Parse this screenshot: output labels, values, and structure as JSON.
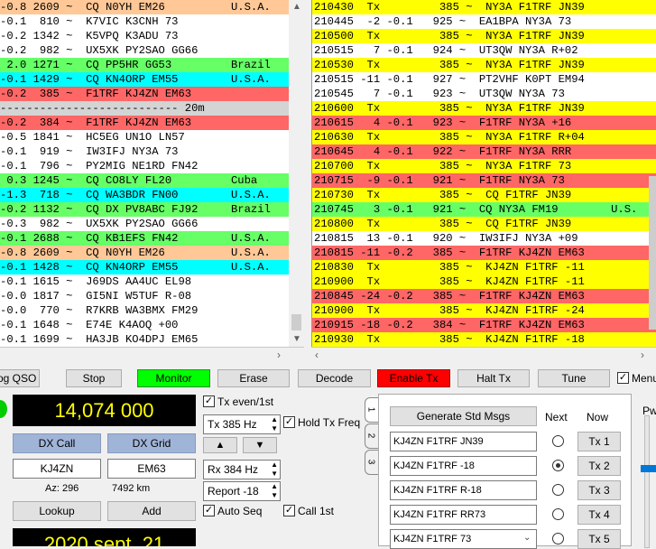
{
  "colors": {
    "cq_peach": "#ffc896",
    "cq_green": "#66ff66",
    "cq_cyan": "#00ffff",
    "to_me_red": "#ff6666",
    "tx_yellow": "#ffff00",
    "monitor_green": "#00ff00",
    "enable_tx_red": "#ff0000",
    "freq_text": "#ffff00"
  },
  "band_activity": {
    "rows": [
      {
        "text": "-0.8 2609 ~  CQ N0YH EM26          U.S.A.",
        "color": "#ffc896"
      },
      {
        "text": "-0.1  810 ~  K7VIC K3CNH 73",
        "color": ""
      },
      {
        "text": "-0.2 1342 ~  K5VPQ K3ADU 73",
        "color": ""
      },
      {
        "text": "-0.2  982 ~  UX5XK PY2SAO GG66",
        "color": ""
      },
      {
        "text": " 2.0 1271 ~  CQ PP5HR GG53         Brazil",
        "color": "#66ff66"
      },
      {
        "text": "-0.1 1429 ~  CQ KN4ORP EM55        U.S.A.",
        "color": "#00ffff"
      },
      {
        "text": "-0.2  385 ~  F1TRF KJ4ZN EM63",
        "color": "#ff6666"
      },
      {
        "text": "--------------------------- 20m",
        "color": "#d4d4d4"
      },
      {
        "text": "-0.2  384 ~  F1TRF KJ4ZN EM63",
        "color": "#ff6666"
      },
      {
        "text": "-0.5 1841 ~  HC5EG UN1O LN57",
        "color": ""
      },
      {
        "text": "-0.1  919 ~  IW3IFJ NY3A 73",
        "color": ""
      },
      {
        "text": "-0.1  796 ~  PY2MIG NE1RD FN42",
        "color": ""
      },
      {
        "text": " 0.3 1245 ~  CQ CO8LY FL20         Cuba",
        "color": "#66ff66"
      },
      {
        "text": "-1.3  718 ~  CQ WA3BDR FN00        U.S.A.",
        "color": "#00ffff"
      },
      {
        "text": "-0.2 1132 ~  CQ DX PV8ABC FJ92     Brazil",
        "color": "#66ff66"
      },
      {
        "text": "-0.3  982 ~  UX5XK PY2SAO GG66",
        "color": ""
      },
      {
        "text": "-0.1 2688 ~  CQ KB1EFS FN42        U.S.A.",
        "color": "#66ff66"
      },
      {
        "text": "-0.8 2609 ~  CQ N0YH EM26          U.S.A.",
        "color": "#ffc896"
      },
      {
        "text": "-0.1 1428 ~  CQ KN4ORP EM55        U.S.A.",
        "color": "#00ffff"
      },
      {
        "text": "-0.1 1615 ~  J69DS AA4UC EL98",
        "color": ""
      },
      {
        "text": "-0.0 1817 ~  GI5NI W5TUF R-08",
        "color": ""
      },
      {
        "text": "-0.0  770 ~  R7KRB WA3BMX FM29",
        "color": ""
      },
      {
        "text": "-0.1 1648 ~  E74E K4AOQ +00",
        "color": ""
      },
      {
        "text": "-0.1 1699 ~  HA3JB KO4DPJ EM65",
        "color": ""
      }
    ]
  },
  "rx_frequency": {
    "rows": [
      {
        "text": "210430  Tx         385 ~  NY3A F1TRF JN39",
        "color": "#ffff00"
      },
      {
        "text": "210445  -2 -0.1   925 ~  EA1BPA NY3A 73",
        "color": ""
      },
      {
        "text": "210500  Tx         385 ~  NY3A F1TRF JN39",
        "color": "#ffff00"
      },
      {
        "text": "210515   7 -0.1   924 ~  UT3QW NY3A R+02",
        "color": ""
      },
      {
        "text": "210530  Tx         385 ~  NY3A F1TRF JN39",
        "color": "#ffff00"
      },
      {
        "text": "210515 -11 -0.1   927 ~  PT2VHF K0PT EM94",
        "color": ""
      },
      {
        "text": "210545   7 -0.1   923 ~  UT3QW NY3A 73",
        "color": ""
      },
      {
        "text": "210600  Tx         385 ~  NY3A F1TRF JN39",
        "color": "#ffff00"
      },
      {
        "text": "210615   4 -0.1   923 ~  F1TRF NY3A +16",
        "color": "#ff6666"
      },
      {
        "text": "210630  Tx         385 ~  NY3A F1TRF R+04",
        "color": "#ffff00"
      },
      {
        "text": "210645   4 -0.1   922 ~  F1TRF NY3A RRR",
        "color": "#ff6666"
      },
      {
        "text": "210700  Tx         385 ~  NY3A F1TRF 73",
        "color": "#ffff00"
      },
      {
        "text": "210715  -9 -0.1   921 ~  F1TRF NY3A 73",
        "color": "#ff6666"
      },
      {
        "text": "210730  Tx         385 ~  CQ F1TRF JN39",
        "color": "#ffff00"
      },
      {
        "text": "210745   3 -0.1   921 ~  CQ NY3A FM19        U.S.",
        "color": "#66ff66"
      },
      {
        "text": "210800  Tx         385 ~  CQ F1TRF JN39",
        "color": "#ffff00"
      },
      {
        "text": "210815  13 -0.1   920 ~  IW3IFJ NY3A +09",
        "color": ""
      },
      {
        "text": "210815 -11 -0.2   385 ~  F1TRF KJ4ZN EM63",
        "color": "#ff6666"
      },
      {
        "text": "210830  Tx         385 ~  KJ4ZN F1TRF -11",
        "color": "#ffff00"
      },
      {
        "text": "210900  Tx         385 ~  KJ4ZN F1TRF -11",
        "color": "#ffff00"
      },
      {
        "text": "210845 -24 -0.2   385 ~  F1TRF KJ4ZN EM63",
        "color": "#ff6666"
      },
      {
        "text": "210900  Tx         385 ~  KJ4ZN F1TRF -24",
        "color": "#ffff00"
      },
      {
        "text": "210915 -18 -0.2   384 ~  F1TRF KJ4ZN EM63",
        "color": "#ff6666"
      },
      {
        "text": "210930  Tx         385 ~  KJ4ZN F1TRF -18",
        "color": "#ffff00"
      }
    ]
  },
  "toolbar": {
    "log_qso": "og QSO",
    "stop": "Stop",
    "monitor": "Monitor",
    "erase": "Erase",
    "decode": "Decode",
    "enable_tx": "Enable Tx",
    "halt_tx": "Halt Tx",
    "tune": "Tune",
    "menus": "Menu"
  },
  "dial_frequency": "14,074 000",
  "date_display": "2020 sept. 21",
  "dx": {
    "call_button": "DX Call",
    "grid_button": "DX Grid",
    "call_value": "KJ4ZN",
    "grid_value": "EM63",
    "azimuth": "Az: 296",
    "distance": "7492 km",
    "lookup": "Lookup",
    "add": "Add"
  },
  "tx_controls": {
    "tx_even": "Tx even/1st",
    "tx_freq": "Tx  385 Hz",
    "hold_tx_freq": "Hold Tx Freq",
    "up_arrow": "▲",
    "down_arrow": "▼",
    "rx_freq": "Rx  384 Hz",
    "report": "Report -18",
    "auto_seq": "Auto Seq",
    "call_1st": "Call 1st"
  },
  "tabs": [
    "1",
    "2",
    "3"
  ],
  "messages": {
    "generate": "Generate Std Msgs",
    "next": "Next",
    "now": "Now",
    "items": [
      {
        "text": "KJ4ZN F1TRF JN39",
        "button": "Tx 1",
        "selected": false
      },
      {
        "text": "KJ4ZN F1TRF -18",
        "button": "Tx 2",
        "selected": true
      },
      {
        "text": "KJ4ZN F1TRF R-18",
        "button": "Tx 3",
        "selected": false
      },
      {
        "text": "KJ4ZN F1TRF RR73",
        "button": "Tx 4",
        "selected": false
      },
      {
        "text": "KJ4ZN F1TRF 73",
        "button": "Tx 5",
        "selected": false
      }
    ]
  },
  "pwr_label": "Pwr"
}
